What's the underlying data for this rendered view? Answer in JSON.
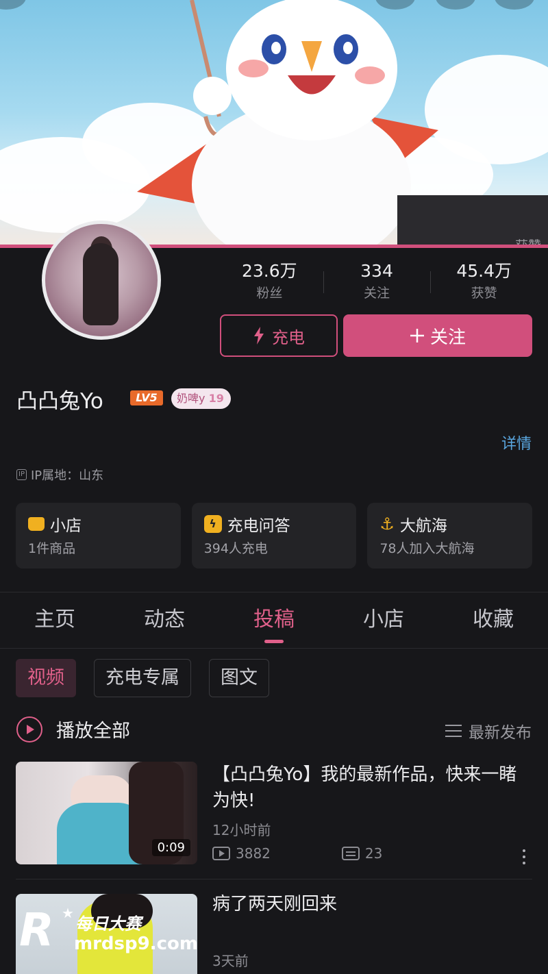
{
  "banner": {
    "faded_label": "获赞"
  },
  "stats": [
    {
      "value": "23.6万",
      "label": "粉丝"
    },
    {
      "value": "334",
      "label": "关注"
    },
    {
      "value": "45.4万",
      "label": "获赞"
    }
  ],
  "actions": {
    "charge_label": "充电",
    "follow_label": "关注",
    "follow_icon": "plus-icon",
    "charge_icon": "lightning-icon"
  },
  "profile": {
    "name": "凸凸兔Yo",
    "level": "LV5",
    "medal_name": "奶啤y",
    "medal_level": "19",
    "detail_link": "详情",
    "ip_tag": "IP",
    "ip_location": "IP属地：山东"
  },
  "cards": [
    {
      "icon": "shop-icon",
      "title": "小店",
      "subtitle": "1件商品"
    },
    {
      "icon": "charge-qa-icon",
      "title": "充电问答",
      "subtitle": "394人充电"
    },
    {
      "icon": "anchor-icon",
      "title": "大航海",
      "subtitle": "78人加入大航海"
    }
  ],
  "tabs": [
    {
      "label": "主页",
      "active": false
    },
    {
      "label": "动态",
      "active": false
    },
    {
      "label": "投稿",
      "active": true
    },
    {
      "label": "小店",
      "active": false
    },
    {
      "label": "收藏",
      "active": false
    }
  ],
  "chips": [
    {
      "label": "视频",
      "active": true
    },
    {
      "label": "充电专属",
      "active": false
    },
    {
      "label": "图文",
      "active": false
    }
  ],
  "list_header": {
    "play_all": "播放全部",
    "sort": "最新发布"
  },
  "videos": [
    {
      "title": "【凸凸兔Yo】我的最新作品，快来一睹为快!",
      "time": "12小时前",
      "duration": "0:09",
      "plays": "3882",
      "comments": "23"
    },
    {
      "title": "病了两天刚回来",
      "time": "3天前"
    }
  ],
  "watermark": {
    "letter": "R",
    "star": "★",
    "text": "每日大赛",
    "url": "mrdsp9.com"
  },
  "colors": {
    "accent": "#d14f7c",
    "link": "#5aa7e0",
    "background": "#17171a",
    "card": "#232326",
    "badge_orange": "#e86a2a",
    "icon_gold": "#f0b020"
  }
}
